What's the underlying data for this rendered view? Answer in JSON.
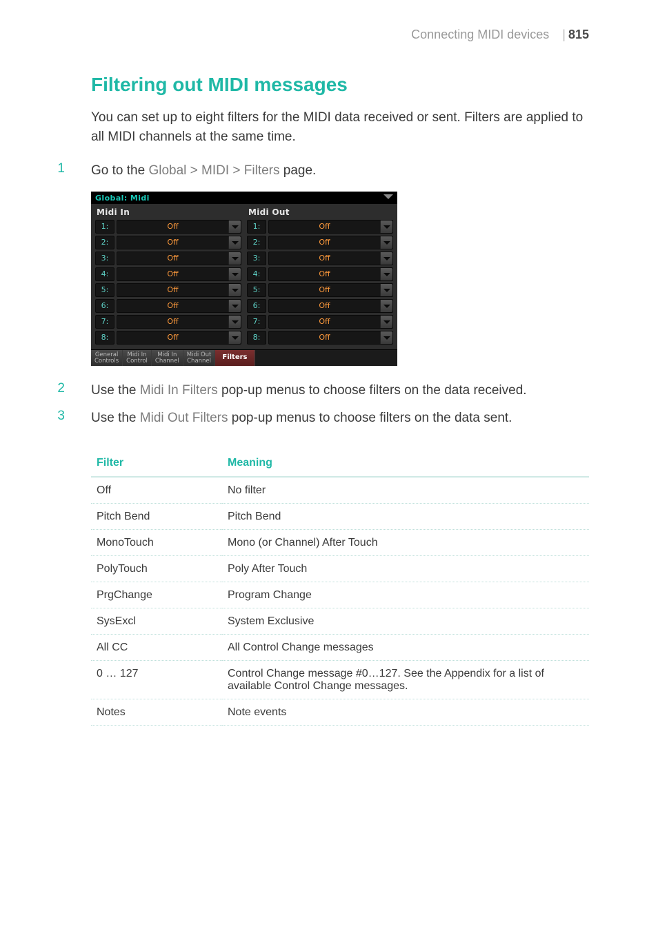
{
  "header": {
    "section": "Connecting MIDI devices",
    "page": "815"
  },
  "title": "Filtering out MIDI messages",
  "intro": "You can set up to eight filters for the MIDI data received or sent. Filters are applied to all MIDI channels at the same time.",
  "steps": [
    {
      "n": "1",
      "pre": "Go to the ",
      "emph": "Global > MIDI > Filters",
      "post": " page."
    },
    {
      "n": "2",
      "pre": "Use the ",
      "emph": "Midi In Filters",
      "post": " pop-up menus to choose filters on the data received."
    },
    {
      "n": "3",
      "pre": "Use the ",
      "emph": "Midi Out Filters",
      "post": " pop-up menus to choose filters on the data sent."
    }
  ],
  "device": {
    "title": "Global: Midi",
    "midi_in_label": "Midi In",
    "midi_out_label": "Midi Out",
    "in": [
      {
        "n": "1:",
        "v": "Off"
      },
      {
        "n": "2:",
        "v": "Off"
      },
      {
        "n": "3:",
        "v": "Off"
      },
      {
        "n": "4:",
        "v": "Off"
      },
      {
        "n": "5:",
        "v": "Off"
      },
      {
        "n": "6:",
        "v": "Off"
      },
      {
        "n": "7:",
        "v": "Off"
      },
      {
        "n": "8:",
        "v": "Off"
      }
    ],
    "out": [
      {
        "n": "1:",
        "v": "Off"
      },
      {
        "n": "2:",
        "v": "Off"
      },
      {
        "n": "3:",
        "v": "Off"
      },
      {
        "n": "4:",
        "v": "Off"
      },
      {
        "n": "5:",
        "v": "Off"
      },
      {
        "n": "6:",
        "v": "Off"
      },
      {
        "n": "7:",
        "v": "Off"
      },
      {
        "n": "8:",
        "v": "Off"
      }
    ],
    "tabs": {
      "t0": "General\nControls",
      "t1": "Midi In\nControl",
      "t2": "Midi In\nChannel",
      "t3": "Midi Out\nChannel",
      "t4": "Filters"
    }
  },
  "filter_table": {
    "head": {
      "c0": "Filter",
      "c1": "Meaning"
    },
    "rows": [
      {
        "k": "Off",
        "v": "No filter"
      },
      {
        "k": "Pitch Bend",
        "v": "Pitch Bend"
      },
      {
        "k": "MonoTouch",
        "v": "Mono (or Channel) After Touch"
      },
      {
        "k": "PolyTouch",
        "v": "Poly After Touch"
      },
      {
        "k": "PrgChange",
        "v": "Program Change"
      },
      {
        "k": "SysExcl",
        "v": "System Exclusive"
      },
      {
        "k": "All CC",
        "v": "All Control Change messages"
      },
      {
        "k": "0 … 127",
        "v": "Control Change message #0…127. See the Appendix for a list of available Control Change messages."
      },
      {
        "k": "Notes",
        "v": "Note events"
      }
    ]
  }
}
